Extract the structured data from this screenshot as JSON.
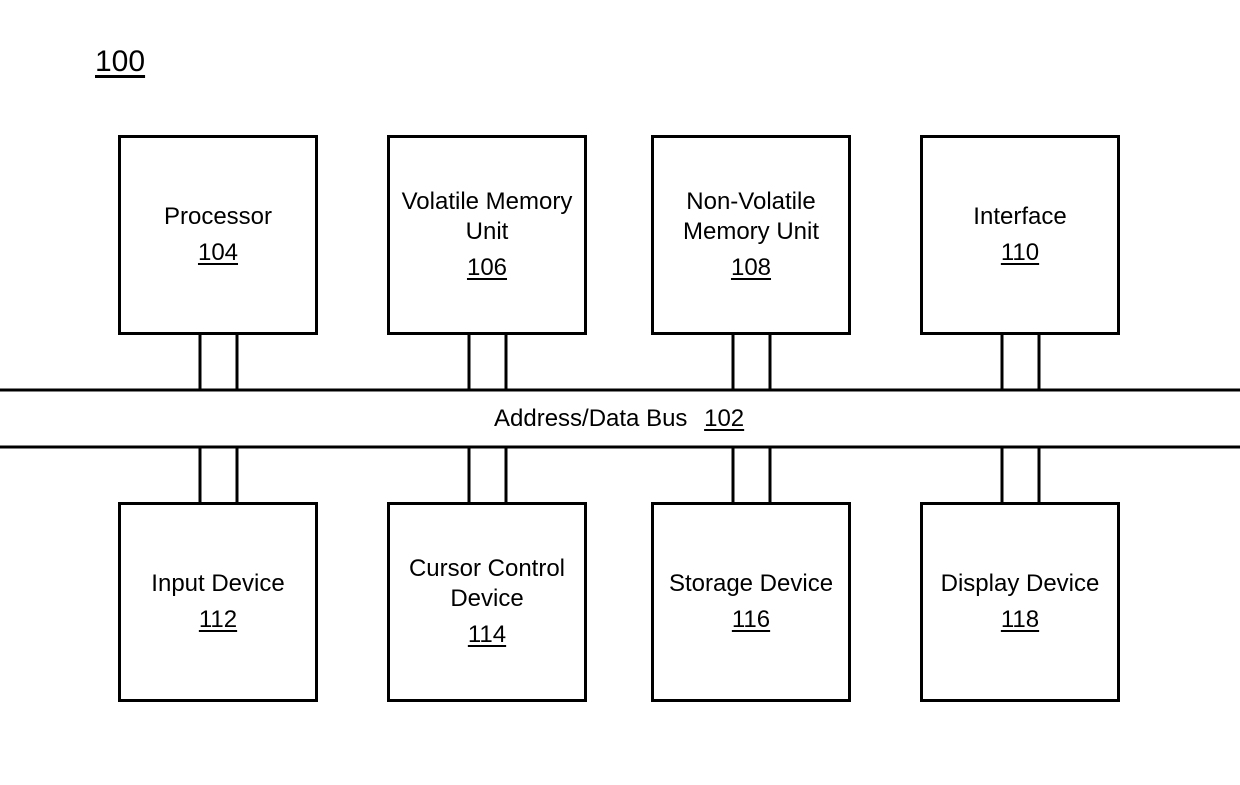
{
  "figure": {
    "number": "100"
  },
  "bus": {
    "label": "Address/Data Bus",
    "ref": "102"
  },
  "top_boxes": [
    {
      "label": "Processor",
      "ref": "104"
    },
    {
      "label": "Volatile Memory Unit",
      "ref": "106"
    },
    {
      "label": "Non-Volatile Memory Unit",
      "ref": "108"
    },
    {
      "label": "Interface",
      "ref": "110"
    }
  ],
  "bottom_boxes": [
    {
      "label": "Input Device",
      "ref": "112"
    },
    {
      "label": "Cursor Control Device",
      "ref": "114"
    },
    {
      "label": "Storage Device",
      "ref": "116"
    },
    {
      "label": "Display Device",
      "ref": "118"
    }
  ]
}
